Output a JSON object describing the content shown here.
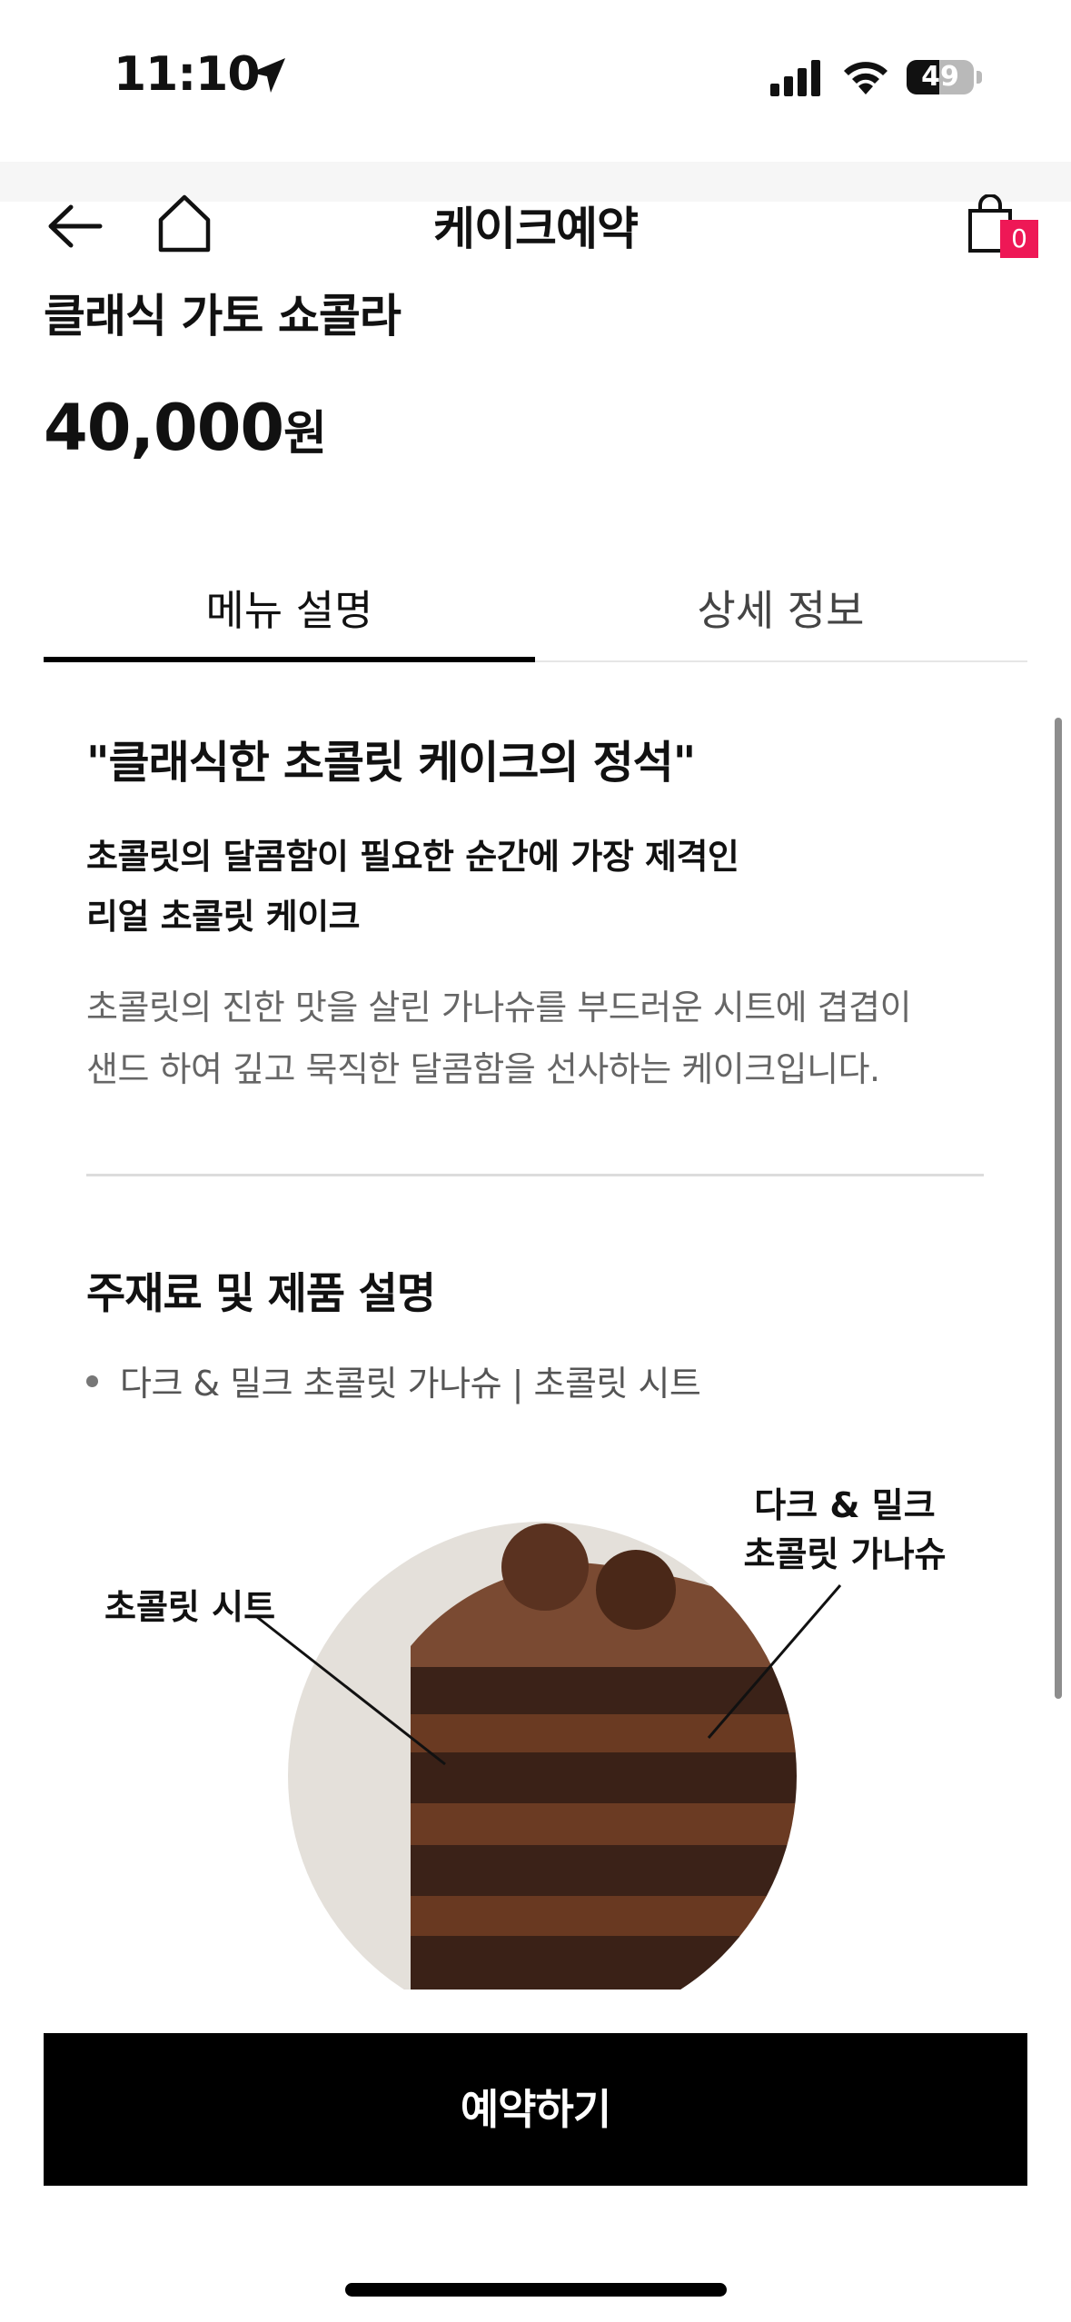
{
  "status_bar": {
    "time": "11:10",
    "battery": "49",
    "battery_level": 0.49,
    "icons": [
      "location-arrow-icon",
      "cellular-signal-icon",
      "wifi-icon",
      "battery-icon"
    ]
  },
  "header": {
    "title": "케이크예약",
    "cart_count": "0",
    "icons": [
      "back-arrow-icon",
      "home-icon",
      "shopping-bag-icon"
    ],
    "badge_color": "#ee1856"
  },
  "product": {
    "name": "클래식 가토 쇼콜라",
    "price": "40,000",
    "price_unit": "원"
  },
  "tabs": [
    {
      "label": "메뉴 설명",
      "active": true
    },
    {
      "label": "상세 정보",
      "active": false
    }
  ],
  "description": {
    "quote": "\"클래식한 초콜릿 케이크의 정석\"",
    "subtitle_lines": [
      "초콜릿의 달콤함이 필요한 순간에 가장 제격인",
      "리얼 초콜릿 케이크"
    ],
    "body_lines": [
      "초콜릿의 진한 맛을 살린 가나슈를 부드러운 시트에 겹겹이",
      "샌드 하여 깊고 묵직한 달콤함을 선사하는 케이크입니다."
    ]
  },
  "ingredients": {
    "title": "주재료 및 제품 설명",
    "items": [
      "다크 & 밀크 초콜릿 가나슈 | 초콜릿 시트"
    ]
  },
  "illustration": {
    "label_sheet": "초콜릿 시트",
    "label_ganache_lines": [
      "다크 & 밀크",
      "초콜릿 가나슈"
    ]
  },
  "cta": {
    "label": "예약하기"
  },
  "colors": {
    "primary": "#000000",
    "accent": "#ee1856",
    "muted_text": "#666666"
  }
}
